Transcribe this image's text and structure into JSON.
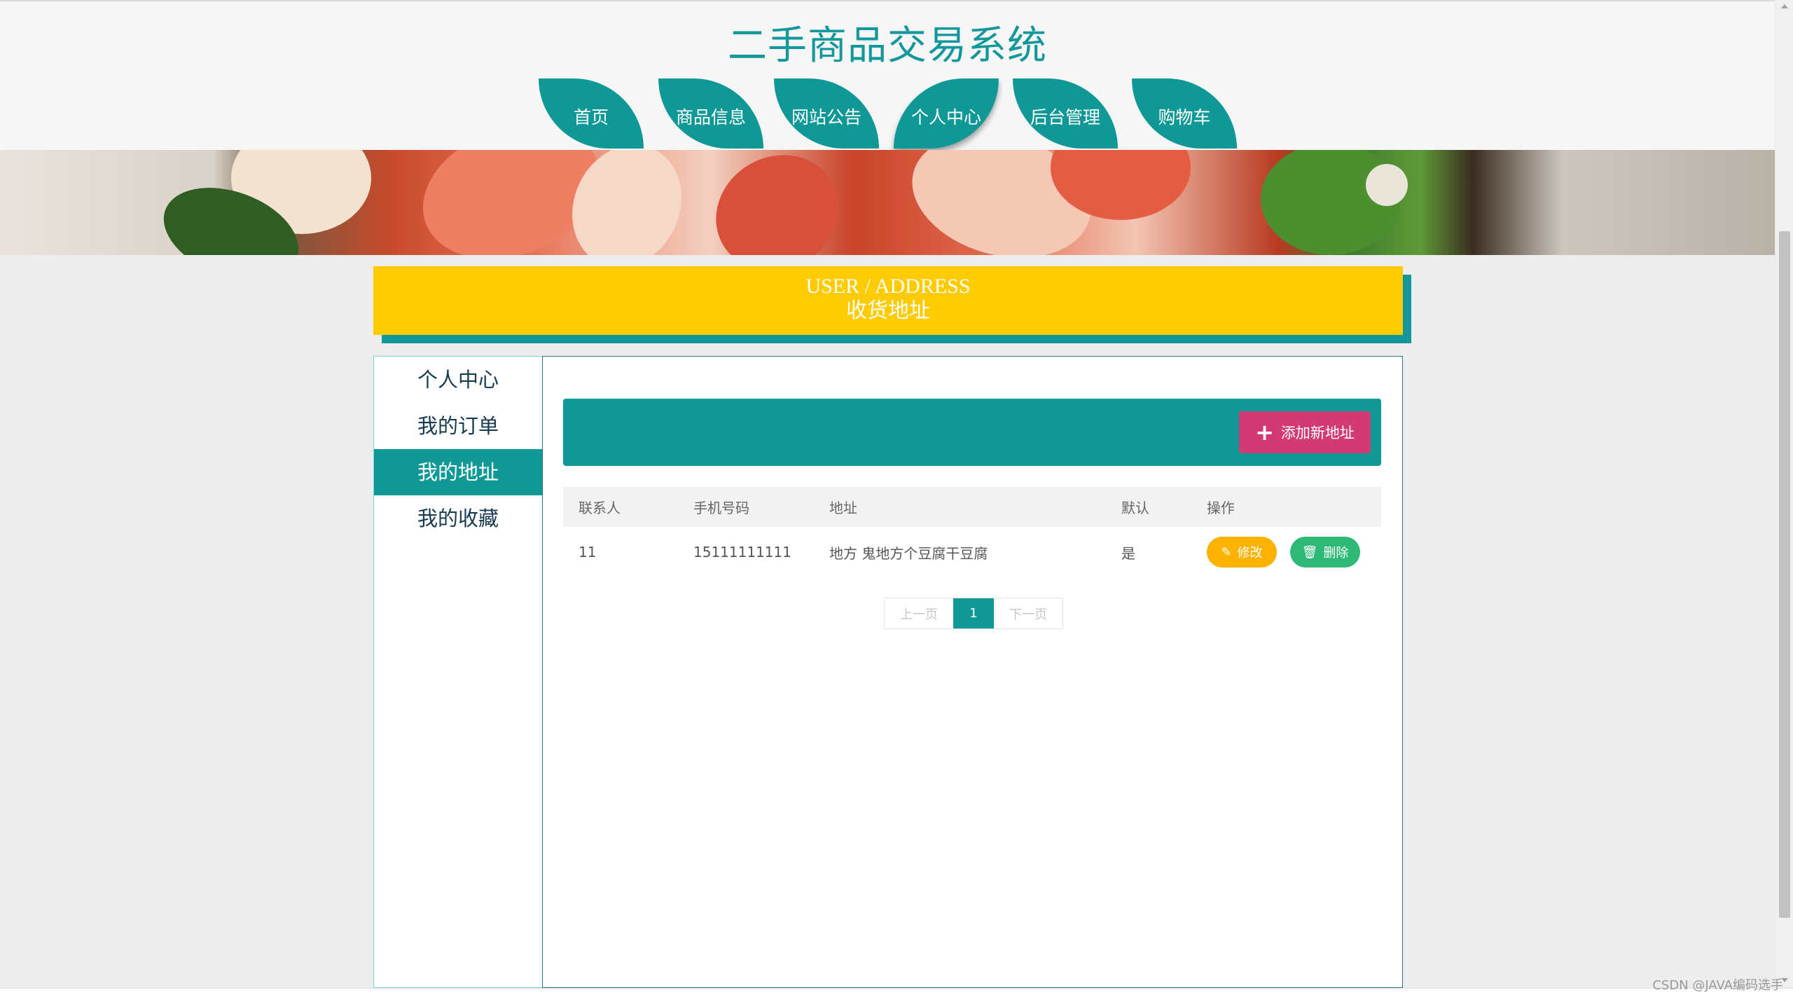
{
  "header": {
    "site_title": "二手商品交易系统",
    "nav": [
      {
        "label": "首页",
        "name": "nav-item-home"
      },
      {
        "label": "商品信息",
        "name": "nav-item-products"
      },
      {
        "label": "网站公告",
        "name": "nav-item-announcements"
      },
      {
        "label": "个人中心",
        "name": "nav-item-user-center"
      },
      {
        "label": "后台管理",
        "name": "nav-item-admin"
      },
      {
        "label": "购物车",
        "name": "nav-item-cart"
      }
    ],
    "active_nav": "个人中心"
  },
  "section": {
    "title_en": "USER / ADDRESS",
    "title_zh": "收货地址"
  },
  "sidebar": {
    "items": [
      {
        "label": "个人中心"
      },
      {
        "label": "我的订单"
      },
      {
        "label": "我的地址"
      },
      {
        "label": "我的收藏"
      }
    ],
    "active": "我的地址"
  },
  "toolbar": {
    "add_label": "添加新地址"
  },
  "table": {
    "columns": [
      "联系人",
      "手机号码",
      "地址",
      "默认",
      "操作"
    ],
    "rows": [
      {
        "contact": "11",
        "phone": "15111111111",
        "address": "地方 鬼地方个豆腐干豆腐",
        "default": "是",
        "edit_label": "修改",
        "delete_label": "删除"
      }
    ]
  },
  "pagination": {
    "prev_label": "上一页",
    "current": "1",
    "next_label": "下一页"
  },
  "watermark": "CSDN @JAVA编码选手",
  "colors": {
    "primary": "#0f9896",
    "accent_yellow": "#fecb00",
    "add_button": "#d23a73",
    "edit_button": "#fcb300",
    "delete_button": "#2fb977"
  }
}
